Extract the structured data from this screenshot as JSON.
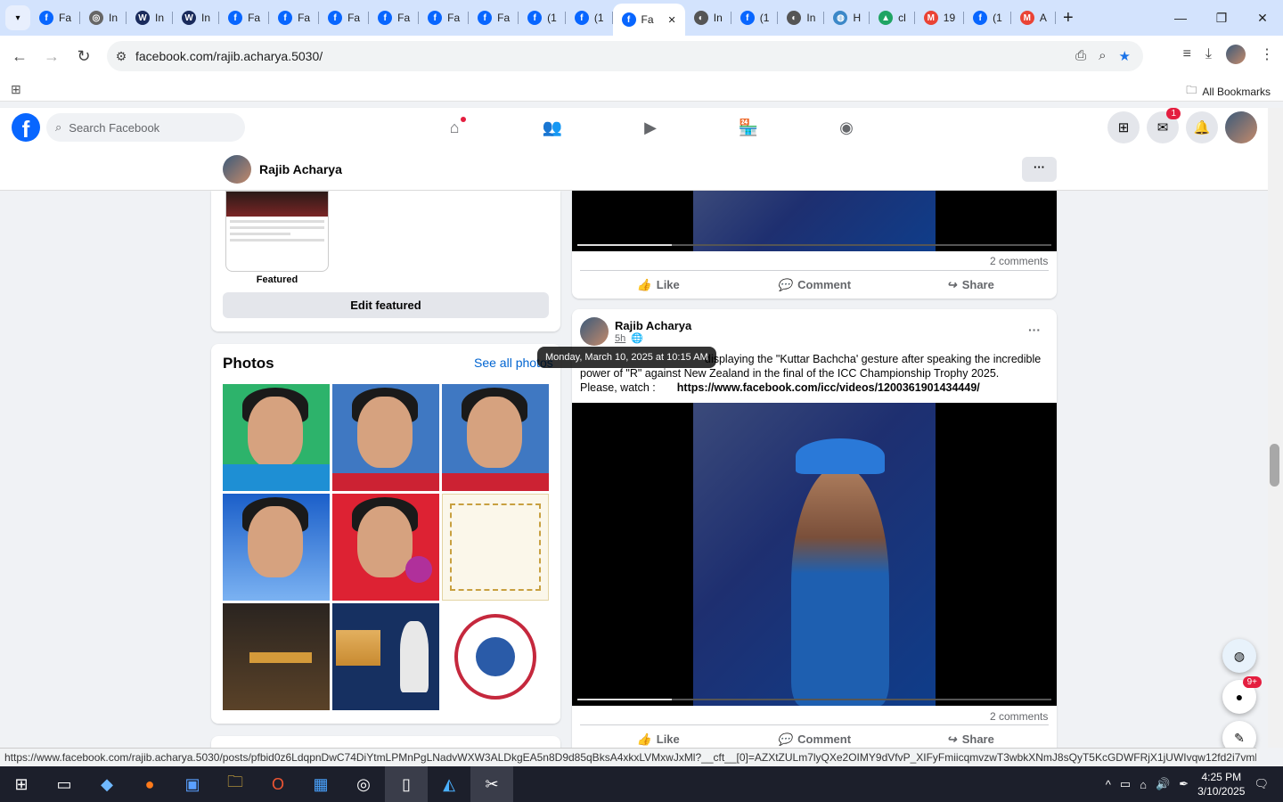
{
  "tabs": [
    {
      "label": "Fa",
      "fav": "f",
      "color": "#0866ff"
    },
    {
      "label": "In",
      "fav": "◎",
      "color": "#666"
    },
    {
      "label": "In",
      "fav": "W",
      "color": "#1a2b5c"
    },
    {
      "label": "In",
      "fav": "W",
      "color": "#1a2b5c"
    },
    {
      "label": "Fa",
      "fav": "f",
      "color": "#0866ff"
    },
    {
      "label": "Fa",
      "fav": "f",
      "color": "#0866ff"
    },
    {
      "label": "Fa",
      "fav": "f",
      "color": "#0866ff"
    },
    {
      "label": "Fa",
      "fav": "f",
      "color": "#0866ff"
    },
    {
      "label": "Fa",
      "fav": "f",
      "color": "#0866ff"
    },
    {
      "label": "Fa",
      "fav": "f",
      "color": "#0866ff"
    },
    {
      "label": "(1",
      "fav": "f",
      "color": "#0866ff"
    },
    {
      "label": "(1",
      "fav": "f",
      "color": "#0866ff"
    },
    {
      "label": "Fa",
      "fav": "f",
      "color": "#0866ff",
      "active": true
    },
    {
      "label": "In",
      "fav": "◐",
      "color": "#555"
    },
    {
      "label": "(1",
      "fav": "f",
      "color": "#0866ff"
    },
    {
      "label": "In",
      "fav": "◐",
      "color": "#555"
    },
    {
      "label": "H",
      "fav": "◍",
      "color": "#3c88c8"
    },
    {
      "label": "cl",
      "fav": "▲",
      "color": "#1fa463"
    },
    {
      "label": "19",
      "fav": "M",
      "color": "#ea4335"
    },
    {
      "label": "(1",
      "fav": "f",
      "color": "#0866ff"
    },
    {
      "label": "A",
      "fav": "M",
      "color": "#ea4335"
    }
  ],
  "omnibox": {
    "url": "facebook.com/rajib.acharya.5030/"
  },
  "bookmarks": {
    "all_label": "All Bookmarks"
  },
  "fb": {
    "search_placeholder": "Search Facebook",
    "messenger_badge": "1",
    "profile_name": "Rajib Acharya",
    "featured_label": "Featured",
    "edit_featured": "Edit featured",
    "photos_title": "Photos",
    "see_all": "See all photos"
  },
  "post1": {
    "comments": "2 comments"
  },
  "post2": {
    "author": "Rajib Acharya",
    "time": "5h",
    "text_line1": "displaying  the \"Kuttar Bachcha' gesture after speaking  the incredible",
    "text_line2": "power of \"R\" against New Zealand in the final of the ICC Championship Trophy 2025.",
    "watch_label": "Please, watch :",
    "link": "https://www.facebook.com/icc/videos/1200361901434449/",
    "comments": "2 comments"
  },
  "actions": {
    "like": "Like",
    "comment": "Comment",
    "share": "Share"
  },
  "tooltip": "Monday, March 10, 2025 at 10:15 AM",
  "status_url": "https://www.facebook.com/rajib.acharya.5030/posts/pfbid0z6LdqpnDwC74DiYtmLPMnPgLNadvWXW3ALDkgEA5n8D9d85qBksA4xkxLVMxwJxMl?__cft__[0]=AZXtZULm7lyQXe2OIMY9dVfvP_XIFyFmiicqmvzwT3wbkXNmJ8sQyT5KcGDWFRjX1jUWIvqw12fd2i7vmNrma...",
  "float_badge": "9+",
  "clock": {
    "time": "4:25 PM",
    "date": "3/10/2025"
  }
}
